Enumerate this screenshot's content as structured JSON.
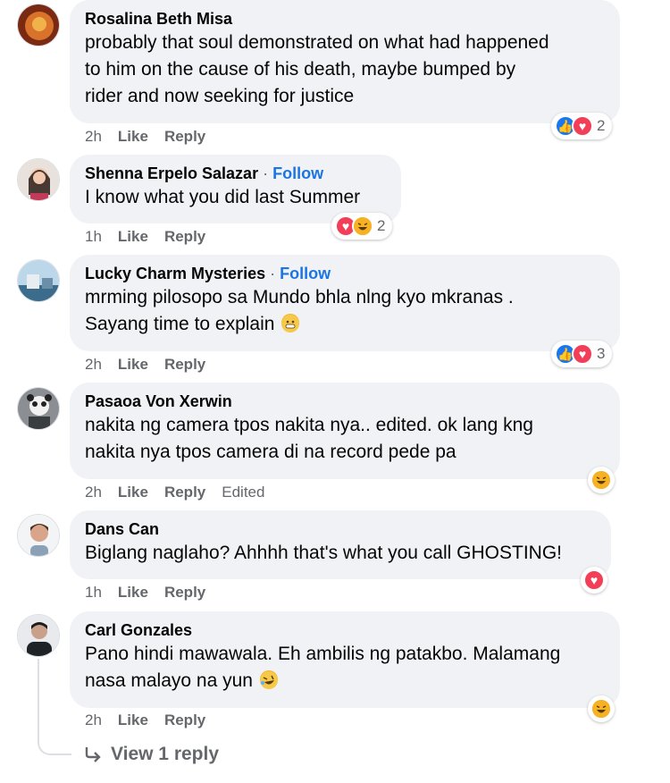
{
  "comments": [
    {
      "author": "Rosalina Beth Misa",
      "follow": "",
      "text_lines": [
        "probably that soul demonstrated on what had happened",
        "to him on the cause of his death, maybe bumped by",
        "rider and now seeking for justice"
      ],
      "time": "2h",
      "like": "Like",
      "reply": "Reply",
      "edited": "",
      "reaction_count": "2",
      "reactions": [
        "like-icon",
        "heart-icon"
      ]
    },
    {
      "author": "Shenna Erpelo Salazar",
      "follow": "Follow",
      "text_lines": [
        "I know what you did last Summer"
      ],
      "time": "1h",
      "like": "Like",
      "reply": "Reply",
      "edited": "",
      "reaction_count": "2",
      "reactions": [
        "heart-icon",
        "haha-icon"
      ]
    },
    {
      "author": "Lucky Charm Mysteries",
      "follow": "Follow",
      "text_lines": [
        "mrming pilosopo sa Mundo bhla nlng kyo mkranas .",
        "Sayang time to explain"
      ],
      "time": "2h",
      "like": "Like",
      "reply": "Reply",
      "edited": "",
      "reaction_count": "3",
      "reactions": [
        "like-icon",
        "heart-icon"
      ]
    },
    {
      "author": "Pasaoa Von Xerwin",
      "follow": "",
      "text_lines": [
        "nakita ng camera tpos nakita nya.. edited. ok lang kng",
        "nakita nya tpos camera di na record pede pa"
      ],
      "time": "2h",
      "like": "Like",
      "reply": "Reply",
      "edited": "Edited",
      "reaction_count": "",
      "reactions": [
        "haha-icon"
      ]
    },
    {
      "author": "Dans Can",
      "follow": "",
      "text_lines": [
        "Biglang naglaho? Ahhhh that's what you call GHOSTING!"
      ],
      "time": "1h",
      "like": "Like",
      "reply": "Reply",
      "edited": "",
      "reaction_count": "",
      "reactions": [
        "heart-icon"
      ]
    },
    {
      "author": "Carl Gonzales",
      "follow": "",
      "text_lines": [
        "Pano hindi mawawala. Eh ambilis ng patakbo. Malamang",
        "nasa malayo na yun"
      ],
      "time": "2h",
      "like": "Like",
      "reply": "Reply",
      "edited": "",
      "reaction_count": "",
      "reactions": [
        "haha-icon"
      ]
    }
  ],
  "dot_separator": "·",
  "view_replies": "View 1 reply",
  "colors": {
    "bubble": "#f0f2f5",
    "link_blue": "#1b74e4",
    "meta_gray": "#65676b",
    "like_blue": "#1877f2",
    "heart_red": "#f33e58",
    "haha_yellow": "#f7b125"
  }
}
